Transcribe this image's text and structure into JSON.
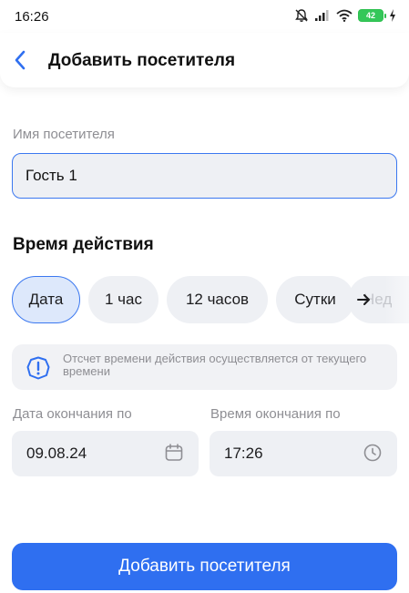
{
  "status_bar": {
    "time": "16:26",
    "battery": "42"
  },
  "header": {
    "title": "Добавить посетителя"
  },
  "visitor_name": {
    "label": "Имя посетителя",
    "value": "Гость 1"
  },
  "validity": {
    "title": "Время действия",
    "options": [
      "Дата",
      "1 час",
      "12 часов",
      "Сутки",
      "Неделя"
    ],
    "selected": "Дата",
    "more_partial_label": "Нед"
  },
  "info": {
    "text": "Отсчет времени действия осуществляется от текущего времени"
  },
  "end_date": {
    "label": "Дата окончания по",
    "value": "09.08.24"
  },
  "end_time": {
    "label": "Время окончания по",
    "value": "17:26"
  },
  "submit": {
    "label": "Добавить посетителя"
  },
  "colors": {
    "accent": "#2f6ff0",
    "chip_bg": "#eef0f4",
    "chip_selected_bg": "#dde8fb"
  },
  "icons": [
    "bell-off-icon",
    "signal-icon",
    "wifi-icon",
    "battery-icon",
    "charging-icon",
    "back-chevron-icon",
    "arrow-right-icon",
    "info-icon",
    "calendar-icon",
    "clock-icon"
  ]
}
